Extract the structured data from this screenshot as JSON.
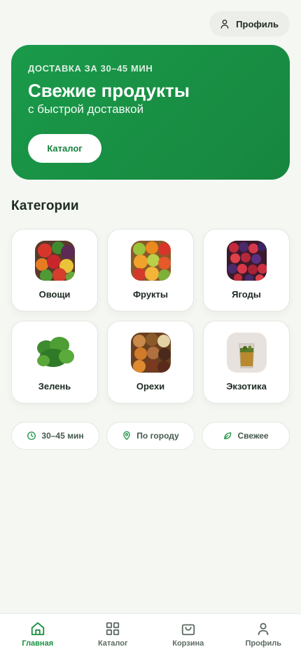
{
  "header": {
    "profile_label": "Профиль",
    "profile_icon": "user-icon"
  },
  "hero": {
    "kicker": "ДОСТАВКА ЗА 30–45 МИН",
    "title": "Свежие продукты",
    "subtitle": "с быстрой доставкой",
    "button_label": "Каталог",
    "color": "#1a9a4a"
  },
  "categories": {
    "title": "Категории",
    "items": [
      {
        "label": "Овощи",
        "image": "vegetables"
      },
      {
        "label": "Фрукты",
        "image": "fruits"
      },
      {
        "label": "Ягоды",
        "image": "berries"
      },
      {
        "label": "Зелень",
        "image": "greens"
      },
      {
        "label": "Орехи",
        "image": "nuts"
      },
      {
        "label": "Экзотика",
        "image": "exotic-drink"
      }
    ]
  },
  "features": [
    {
      "label": "30–45 мин",
      "icon": "clock-icon"
    },
    {
      "label": "По городу",
      "icon": "location-pin-icon"
    },
    {
      "label": "Свежее",
      "icon": "leaf-icon"
    }
  ],
  "nav": {
    "items": [
      {
        "label": "Главная",
        "icon": "home-icon",
        "active": true
      },
      {
        "label": "Каталог",
        "icon": "grid-icon",
        "active": false
      },
      {
        "label": "Корзина",
        "icon": "shopping-bag-icon",
        "active": false
      },
      {
        "label": "Профиль",
        "icon": "user-icon",
        "active": false
      }
    ],
    "active_color": "#17903f"
  }
}
